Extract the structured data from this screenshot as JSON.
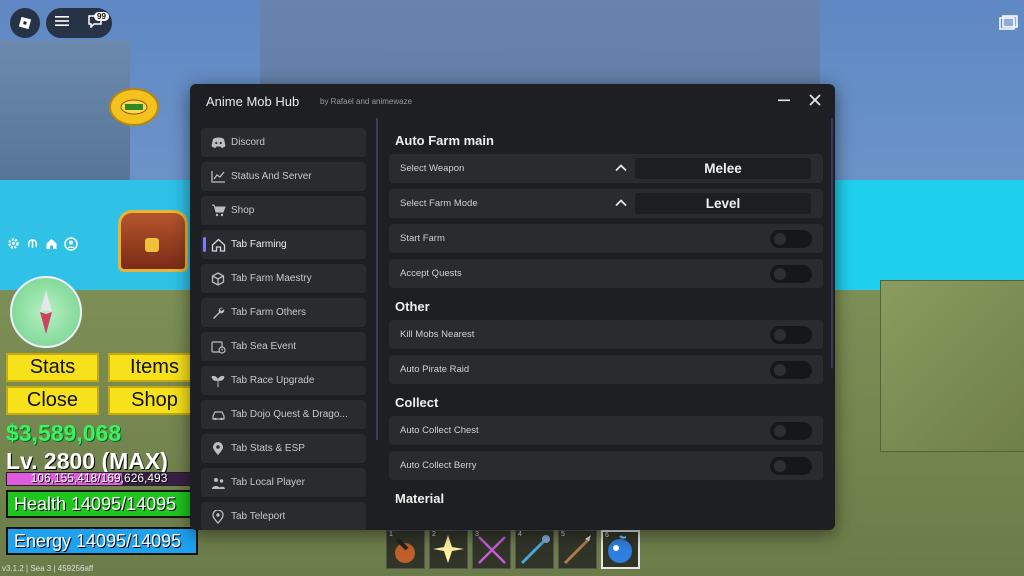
{
  "window": {
    "title": "Anime Mob Hub",
    "subtitle": "by Rafael and animewaze"
  },
  "sidebar": {
    "items": [
      {
        "label": "Discord",
        "icon": "discord-icon"
      },
      {
        "label": "Status And Server",
        "icon": "chart-line-icon"
      },
      {
        "label": "Shop",
        "icon": "cart-icon"
      },
      {
        "label": "Tab Farming",
        "icon": "home-icon",
        "active": true
      },
      {
        "label": "Tab Farm Maestry",
        "icon": "cube-icon"
      },
      {
        "label": "Tab Farm Others",
        "icon": "wrench-icon"
      },
      {
        "label": "Tab Sea Event",
        "icon": "calendar-clock-icon"
      },
      {
        "label": "Tab Race Upgrade",
        "icon": "sprout-icon"
      },
      {
        "label": "Tab Dojo Quest & Drago...",
        "icon": "car-icon"
      },
      {
        "label": "Tab Stats & ESP",
        "icon": "map-pin-icon"
      },
      {
        "label": "Tab Local Player",
        "icon": "people-icon"
      },
      {
        "label": "Tab Teleport",
        "icon": "location-icon"
      }
    ]
  },
  "content": {
    "auto_farm": {
      "title": "Auto Farm main",
      "select_weapon": {
        "label": "Select Weapon",
        "value": "Melee"
      },
      "select_farm_mode": {
        "label": "Select Farm Mode",
        "value": "Level"
      },
      "start_farm": "Start Farm",
      "accept_quests": "Accept Quests"
    },
    "other": {
      "title": "Other",
      "kill_mobs": "Kill Mobs Nearest",
      "auto_pirate": "Auto Pirate Raid"
    },
    "collect": {
      "title": "Collect",
      "chest": "Auto Collect Chest",
      "berry": "Auto Collect Berry"
    },
    "material": {
      "title": "Material"
    }
  },
  "hud": {
    "notifications": "99",
    "stats_button": "Stats",
    "items_button": "Items",
    "close_button": "Close",
    "shop_button": "Shop",
    "money": "$3,589,068",
    "level": "Lv. 2800 (MAX)",
    "xp_text": "106,155,418/169,626,493",
    "xp_progress": 0.626,
    "health_text": "Health 14095/14095",
    "energy_text": "Energy 14095/14095",
    "version": "v3.1.2 | Sea 3 | 459256aff",
    "hotbar_slots": [
      "1",
      "2",
      "3",
      "4",
      "5",
      "6"
    ]
  },
  "colors": {
    "accent": "#7a7cff",
    "panel_bg": "#1e1f22",
    "row_bg": "#2a2b2f",
    "hud_button": "#f6e11b",
    "health": "#1ec61e",
    "energy": "#1ea2f0",
    "money": "#3cf45a"
  }
}
